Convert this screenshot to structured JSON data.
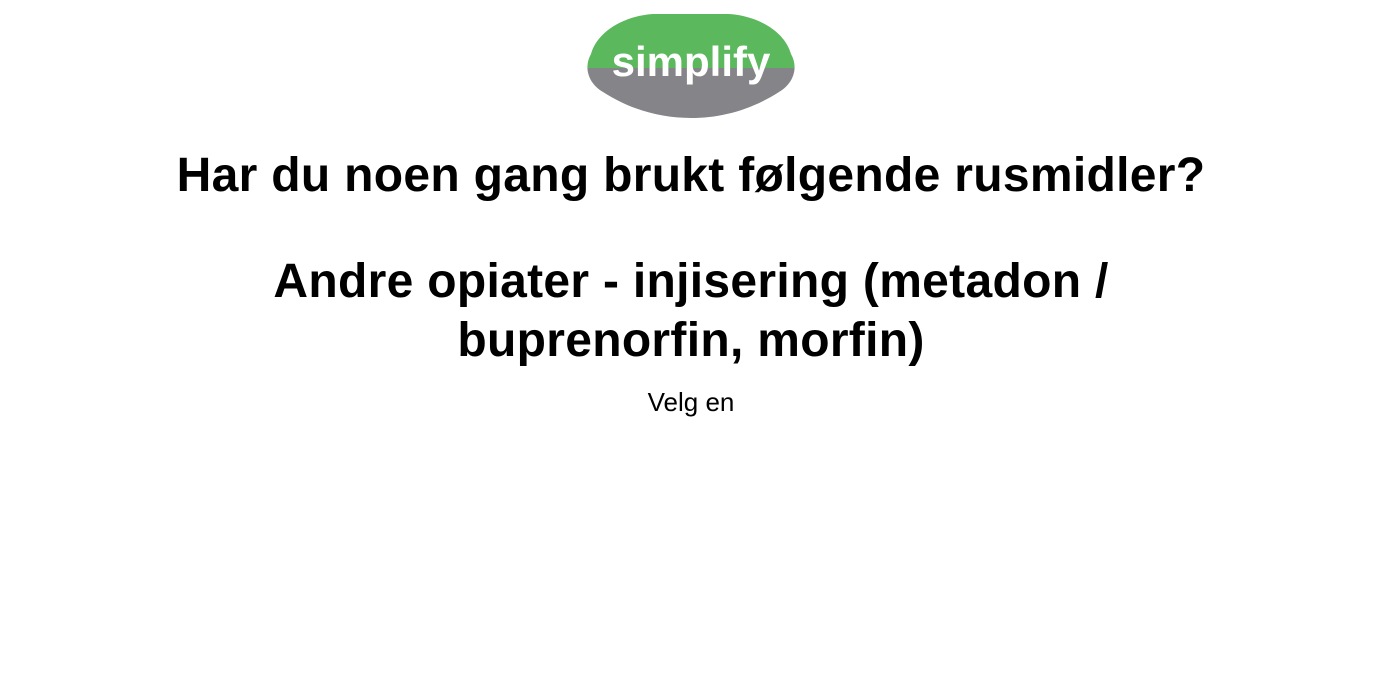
{
  "logo": {
    "text": "simplify",
    "colors": {
      "top": "#5cb85c",
      "bottom": "#858589",
      "text": "#ffffff"
    }
  },
  "question": {
    "title": "Har du noen gang brukt følgende rusmidler?",
    "subtitle": "Andre opiater - injisering (metadon / buprenorfin, morfin)",
    "instruction": "Velg en"
  }
}
